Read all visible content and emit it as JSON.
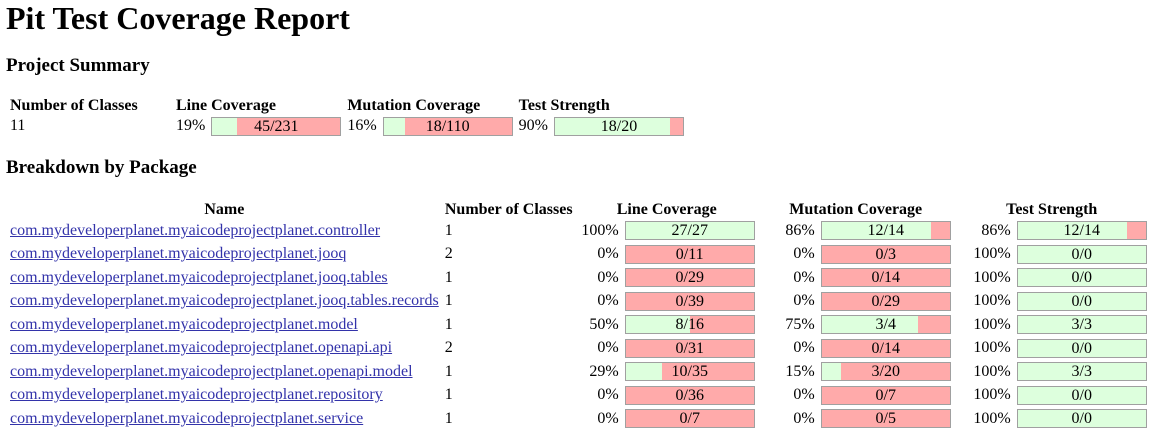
{
  "title": "Pit Test Coverage Report",
  "summary": {
    "heading": "Project Summary",
    "headers": {
      "classes": "Number of Classes",
      "line": "Line Coverage",
      "mutation": "Mutation Coverage",
      "strength": "Test Strength"
    },
    "classes": "11",
    "line": {
      "pct": "19%",
      "text": "45/231",
      "ratio": 0.195
    },
    "mutation": {
      "pct": "16%",
      "text": "18/110",
      "ratio": 0.164
    },
    "strength": {
      "pct": "90%",
      "text": "18/20",
      "ratio": 0.9
    }
  },
  "breakdown": {
    "heading": "Breakdown by Package",
    "headers": {
      "name": "Name",
      "classes": "Number of Classes",
      "line": "Line Coverage",
      "mutation": "Mutation Coverage",
      "strength": "Test Strength"
    },
    "rows": [
      {
        "name": "com.mydeveloperplanet.myaicodeprojectplanet.controller",
        "classes": "1",
        "line": {
          "pct": "100%",
          "text": "27/27",
          "ratio": 1.0
        },
        "mutation": {
          "pct": "86%",
          "text": "12/14",
          "ratio": 0.857
        },
        "strength": {
          "pct": "86%",
          "text": "12/14",
          "ratio": 0.857
        }
      },
      {
        "name": "com.mydeveloperplanet.myaicodeprojectplanet.jooq",
        "classes": "2",
        "line": {
          "pct": "0%",
          "text": "0/11",
          "ratio": 0
        },
        "mutation": {
          "pct": "0%",
          "text": "0/3",
          "ratio": 0
        },
        "strength": {
          "pct": "100%",
          "text": "0/0",
          "ratio": 1.0
        }
      },
      {
        "name": "com.mydeveloperplanet.myaicodeprojectplanet.jooq.tables",
        "classes": "1",
        "line": {
          "pct": "0%",
          "text": "0/29",
          "ratio": 0
        },
        "mutation": {
          "pct": "0%",
          "text": "0/14",
          "ratio": 0
        },
        "strength": {
          "pct": "100%",
          "text": "0/0",
          "ratio": 1.0
        }
      },
      {
        "name": "com.mydeveloperplanet.myaicodeprojectplanet.jooq.tables.records",
        "classes": "1",
        "line": {
          "pct": "0%",
          "text": "0/39",
          "ratio": 0
        },
        "mutation": {
          "pct": "0%",
          "text": "0/29",
          "ratio": 0
        },
        "strength": {
          "pct": "100%",
          "text": "0/0",
          "ratio": 1.0
        }
      },
      {
        "name": "com.mydeveloperplanet.myaicodeprojectplanet.model",
        "classes": "1",
        "line": {
          "pct": "50%",
          "text": "8/16",
          "ratio": 0.5
        },
        "mutation": {
          "pct": "75%",
          "text": "3/4",
          "ratio": 0.75
        },
        "strength": {
          "pct": "100%",
          "text": "3/3",
          "ratio": 1.0
        }
      },
      {
        "name": "com.mydeveloperplanet.myaicodeprojectplanet.openapi.api",
        "classes": "2",
        "line": {
          "pct": "0%",
          "text": "0/31",
          "ratio": 0
        },
        "mutation": {
          "pct": "0%",
          "text": "0/14",
          "ratio": 0
        },
        "strength": {
          "pct": "100%",
          "text": "0/0",
          "ratio": 1.0
        }
      },
      {
        "name": "com.mydeveloperplanet.myaicodeprojectplanet.openapi.model",
        "classes": "1",
        "line": {
          "pct": "29%",
          "text": "10/35",
          "ratio": 0.286
        },
        "mutation": {
          "pct": "15%",
          "text": "3/20",
          "ratio": 0.15
        },
        "strength": {
          "pct": "100%",
          "text": "3/3",
          "ratio": 1.0
        }
      },
      {
        "name": "com.mydeveloperplanet.myaicodeprojectplanet.repository",
        "classes": "1",
        "line": {
          "pct": "0%",
          "text": "0/36",
          "ratio": 0
        },
        "mutation": {
          "pct": "0%",
          "text": "0/7",
          "ratio": 0
        },
        "strength": {
          "pct": "100%",
          "text": "0/0",
          "ratio": 1.0
        }
      },
      {
        "name": "com.mydeveloperplanet.myaicodeprojectplanet.service",
        "classes": "1",
        "line": {
          "pct": "0%",
          "text": "0/7",
          "ratio": 0
        },
        "mutation": {
          "pct": "0%",
          "text": "0/5",
          "ratio": 0
        },
        "strength": {
          "pct": "100%",
          "text": "0/0",
          "ratio": 1.0
        }
      }
    ]
  },
  "colors": {
    "covered": "#ddffdd",
    "uncovered": "#ffaaaa",
    "link": "#3333aa"
  }
}
